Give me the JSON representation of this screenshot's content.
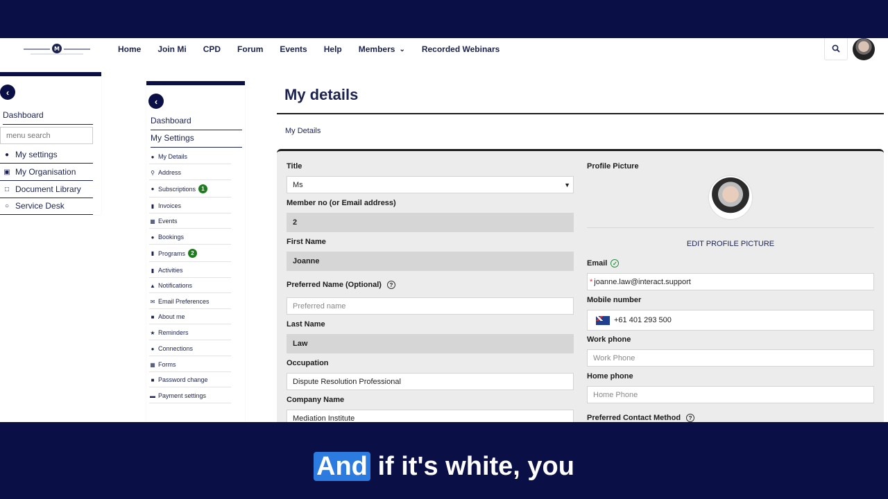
{
  "header": {
    "nav": [
      "Home",
      "Join Mi",
      "CPD",
      "Forum",
      "Events",
      "Help",
      "Members",
      "Recorded Webinars"
    ]
  },
  "sidebar_main": {
    "dashboard": "Dashboard",
    "search_placeholder": "menu search",
    "items": [
      {
        "icon": "user-gear-icon",
        "label": "My settings"
      },
      {
        "icon": "building-icon",
        "label": "My Organisation"
      },
      {
        "icon": "document-icon",
        "label": "Document Library"
      },
      {
        "icon": "headset-icon",
        "label": "Service Desk"
      }
    ]
  },
  "sidebar_settings": {
    "dashboard": "Dashboard",
    "section": "My Settings",
    "items": [
      {
        "icon": "user-gear-icon",
        "label": "My Details",
        "badge": ""
      },
      {
        "icon": "map-pin-icon",
        "label": "Address",
        "badge": ""
      },
      {
        "icon": "users-icon",
        "label": "Subscriptions",
        "badge": "1"
      },
      {
        "icon": "file-icon",
        "label": "Invoices",
        "badge": ""
      },
      {
        "icon": "calendar-icon",
        "label": "Events",
        "badge": ""
      },
      {
        "icon": "bookings-icon",
        "label": "Bookings",
        "badge": ""
      },
      {
        "icon": "clipboard-icon",
        "label": "Programs",
        "badge": "2"
      },
      {
        "icon": "clipboard-icon",
        "label": "Activities",
        "badge": ""
      },
      {
        "icon": "bell-icon",
        "label": "Notifications",
        "badge": ""
      },
      {
        "icon": "envelope-icon",
        "label": "Email Preferences",
        "badge": ""
      },
      {
        "icon": "briefcase-icon",
        "label": "About me",
        "badge": ""
      },
      {
        "icon": "star-icon",
        "label": "Reminders",
        "badge": ""
      },
      {
        "icon": "users-icon",
        "label": "Connections",
        "badge": ""
      },
      {
        "icon": "form-icon",
        "label": "Forms",
        "badge": ""
      },
      {
        "icon": "lock-icon",
        "label": "Password change",
        "badge": ""
      },
      {
        "icon": "credit-card-icon",
        "label": "Payment settings",
        "badge": ""
      }
    ]
  },
  "main": {
    "title": "My details",
    "breadcrumb": "My Details",
    "form": {
      "title_label": "Title",
      "title_value": "Ms",
      "member_no_label": "Member no (or Email address)",
      "member_no_value": "2",
      "first_name_label": "First Name",
      "first_name_value": "Joanne",
      "preferred_name_label": "Preferred Name (Optional)",
      "preferred_name_placeholder": "Preferred name",
      "last_name_label": "Last Name",
      "last_name_value": "Law",
      "occupation_label": "Occupation",
      "occupation_value": "Dispute Resolution Professional",
      "company_label": "Company Name",
      "company_value": "Mediation Institute",
      "profile_picture_label": "Profile Picture",
      "edit_picture": "EDIT PROFILE PICTURE",
      "email_label": "Email",
      "email_value": "joanne.law@interact.support",
      "mobile_label": "Mobile number",
      "mobile_value": "+61 401 293 500",
      "work_phone_label": "Work phone",
      "work_phone_placeholder": "Work Phone",
      "home_phone_label": "Home phone",
      "home_phone_placeholder": "Home Phone",
      "contact_method_label": "Preferred Contact Method"
    }
  },
  "caption": {
    "highlight": "And",
    "rest": " if it's white, you"
  }
}
